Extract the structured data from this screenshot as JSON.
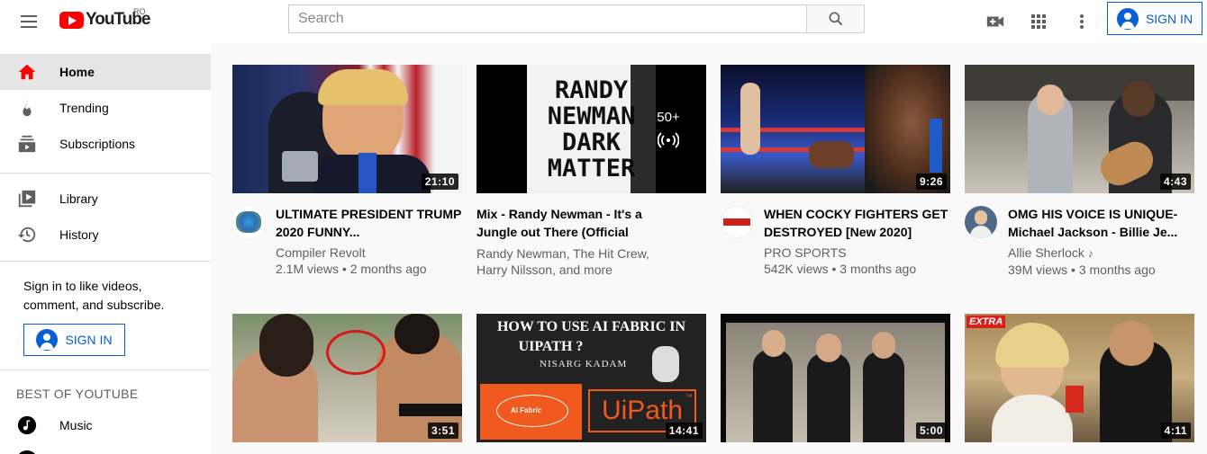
{
  "header": {
    "logo_text": "YouTube",
    "country": "RO",
    "search_placeholder": "Search",
    "signin_label": "SIGN IN",
    "icons": [
      "menu-icon",
      "search-icon",
      "create-video-icon",
      "apps-grid-icon",
      "more-vert-icon"
    ]
  },
  "sidebar": {
    "items": [
      {
        "label": "Home",
        "icon": "home-icon",
        "active": true
      },
      {
        "label": "Trending",
        "icon": "flame-icon"
      },
      {
        "label": "Subscriptions",
        "icon": "subscriptions-icon"
      },
      {
        "label": "Library",
        "icon": "library-icon"
      },
      {
        "label": "History",
        "icon": "history-icon"
      }
    ],
    "signin_prompt": "Sign in to like videos, comment, and subscribe.",
    "signin_label": "SIGN IN",
    "section_title": "BEST OF YOUTUBE",
    "best_of": [
      {
        "label": "Music",
        "icon": "music-note-icon"
      }
    ]
  },
  "colors": {
    "brand_red": "#ff0000",
    "accent_blue": "#065fd4",
    "active_bg": "#e5e5e5"
  },
  "videos": [
    {
      "title": "ULTIMATE PRESIDENT TRUMP 2020 FUNNY...",
      "channel": "Compiler Revolt",
      "views": "2.1M views",
      "age": "2 months ago",
      "duration": "21:10"
    },
    {
      "title": "Mix - Randy Newman - It's a Jungle out There (Official Audio)",
      "artists": "Randy Newman, The Hit Crew, Harry Nilsson, and more",
      "playlist_count": "50+",
      "thumb_text": "RANDY NEWMAN DARK MATTER"
    },
    {
      "title": "WHEN COCKY FIGHTERS GET DESTROYED [New 2020]",
      "channel": "PRO SPORTS",
      "views": "542K views",
      "age": "3 months ago",
      "duration": "9:26"
    },
    {
      "title": "OMG HIS VOICE IS UNIQUE- Michael Jackson - Billie Je...",
      "channel": "Allie Sherlock",
      "views": "39M views",
      "age": "3 months ago",
      "duration": "4:43"
    },
    {
      "duration": "3:51"
    },
    {
      "duration": "14:41",
      "thumb_line1": "HOW TO USE AI FABRIC IN",
      "thumb_line2": "UIPATH ?",
      "thumb_author": "NISARG KADAM",
      "thumb_badge": "Ai Fabric",
      "thumb_logo": "UiPath",
      "thumb_tm": "™"
    },
    {
      "duration": "5:00"
    },
    {
      "duration": "4:11",
      "thumb_badge": "EXTRA"
    }
  ]
}
